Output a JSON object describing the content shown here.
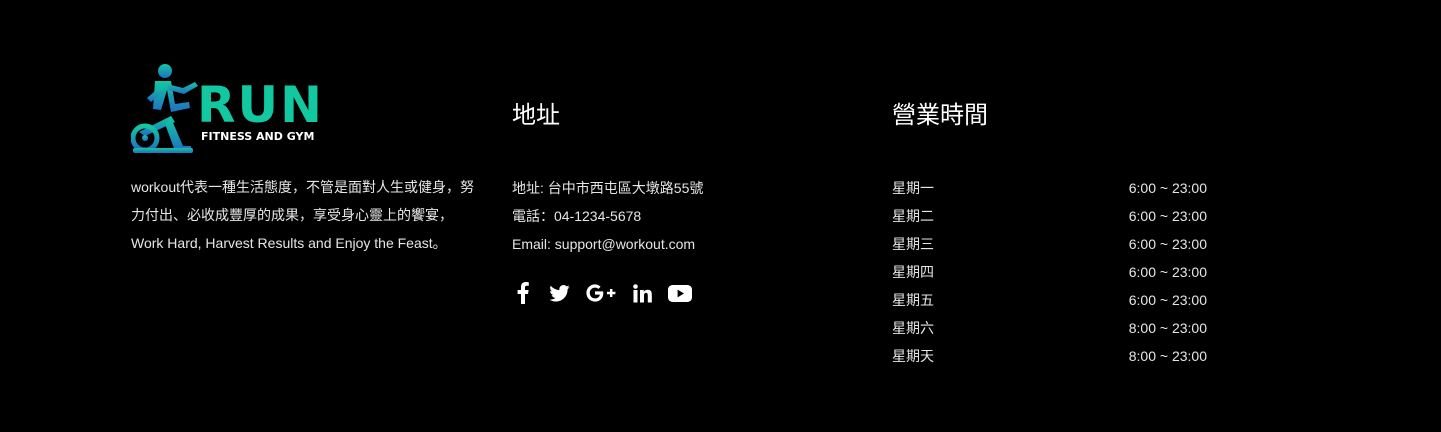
{
  "brand": {
    "logo_text": "RUN",
    "logo_subtitle": "FITNESS AND GYM",
    "description": "workout代表一種生活態度，不管是面對人生或健身，努力付出、必收成豐厚的成果，享受身心靈上的饗宴，Work Hard, Harvest Results and Enjoy the Feast。",
    "colors": {
      "logo_green": "#12c8a0",
      "logo_blue": "#1f6fc4"
    }
  },
  "address": {
    "title": "地址",
    "items": [
      "地址: 台中市西屯區大墩路55號",
      "電話：04-1234-5678",
      "Email: support@workout.com"
    ]
  },
  "social": [
    {
      "icon": "facebook-icon"
    },
    {
      "icon": "twitter-icon"
    },
    {
      "icon": "google-plus-icon"
    },
    {
      "icon": "linkedin-icon"
    },
    {
      "icon": "youtube-icon"
    }
  ],
  "hours": {
    "title": "營業時間",
    "rows": [
      {
        "day": "星期一",
        "time": "6:00 ~ 23:00"
      },
      {
        "day": "星期二",
        "time": "6:00 ~ 23:00"
      },
      {
        "day": "星期三",
        "time": "6:00 ~ 23:00"
      },
      {
        "day": "星期四",
        "time": "6:00 ~ 23:00"
      },
      {
        "day": "星期五",
        "time": "6:00 ~ 23:00"
      },
      {
        "day": "星期六",
        "time": "8:00 ~ 23:00"
      },
      {
        "day": "星期天",
        "time": "8:00 ~ 23:00"
      }
    ]
  }
}
